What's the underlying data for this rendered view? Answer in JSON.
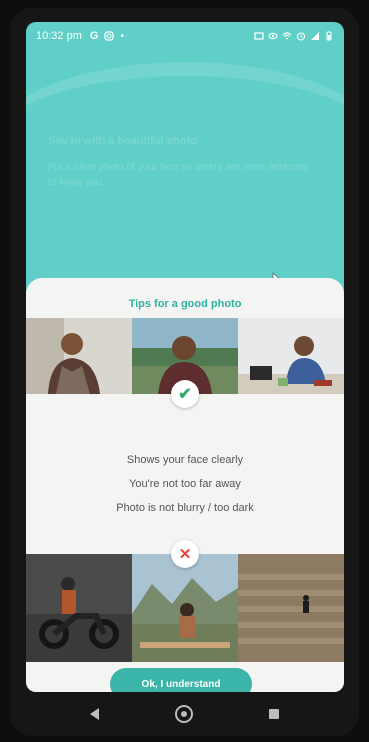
{
  "status_bar": {
    "time": "10:32 pm",
    "left_icons": [
      "google-icon",
      "instagram-icon",
      "dot-icon"
    ],
    "right_icons": [
      "cast-icon",
      "eye-icon",
      "wifi-icon",
      "alarm-icon",
      "signal-icon",
      "battery-icon"
    ]
  },
  "background": {
    "heading": "Say hi with a beautiful photo",
    "subheading": "Put a clear photo of your face so others are more attracted to know you."
  },
  "sheet": {
    "title": "Tips for a good photo",
    "good_tips": [
      "Shows your face clearly",
      "You're not too far away",
      "Photo is not blurry / too dark"
    ],
    "good_badge_icon": "check-icon",
    "bad_badge_icon": "cross-icon",
    "button_label": "Ok, I understand"
  },
  "nav": {
    "back_icon": "back-icon",
    "home_icon": "home-icon",
    "recents_icon": "recents-icon"
  },
  "colors": {
    "accent": "#3bb5aa",
    "background_teal": "#5fcfc7",
    "check": "#29a96b",
    "cross": "#e2463f"
  }
}
